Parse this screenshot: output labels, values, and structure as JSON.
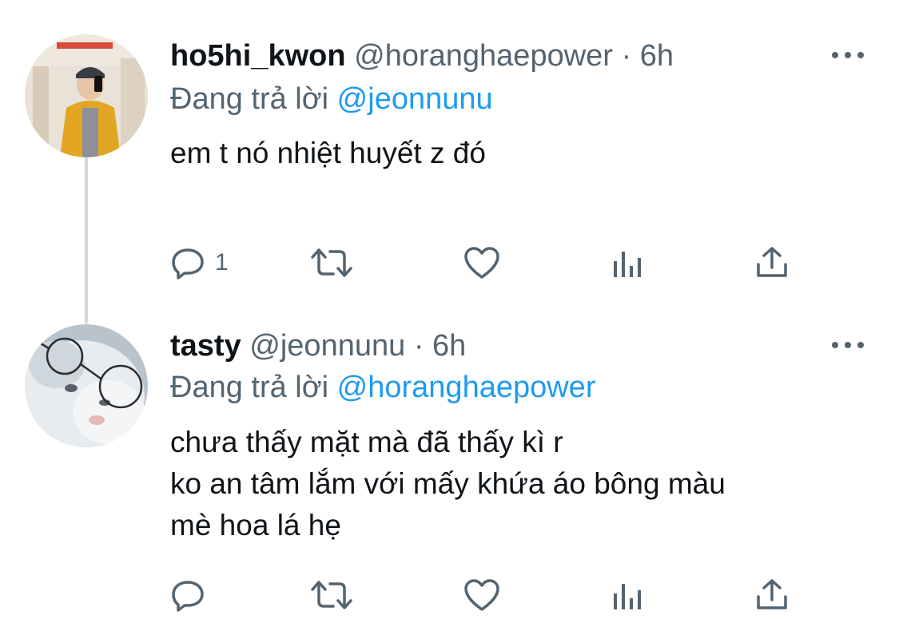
{
  "tweets": [
    {
      "display_name": "ho5hi_kwon",
      "handle": "@horanghaepower",
      "separator": "·",
      "time": "6h",
      "replying_prefix": "Đang trả lời",
      "replying_to": "@jeonnunu",
      "text_lines": [
        "em t nó nhiệt huyết z đó"
      ],
      "reply_count": "1",
      "icons": [
        "reply-icon",
        "retweet-icon",
        "like-icon",
        "analytics-icon",
        "share-icon"
      ]
    },
    {
      "display_name": "tasty",
      "handle": "@jeonnunu",
      "separator": "·",
      "time": "6h",
      "replying_prefix": "Đang trả lời",
      "replying_to": "@horanghaepower",
      "text_lines": [
        "chưa thấy mặt mà đã thấy kì r",
        "ko an tâm lắm với mấy khứa áo bông màu",
        "mè hoa lá hẹ"
      ],
      "reply_count": "",
      "icons": [
        "reply-icon",
        "retweet-icon",
        "like-icon",
        "analytics-icon",
        "share-icon"
      ]
    }
  ],
  "colors": {
    "text": "#0f1419",
    "muted": "#536471",
    "link": "#1d9bf0",
    "thread_line": "#cfd9de"
  }
}
